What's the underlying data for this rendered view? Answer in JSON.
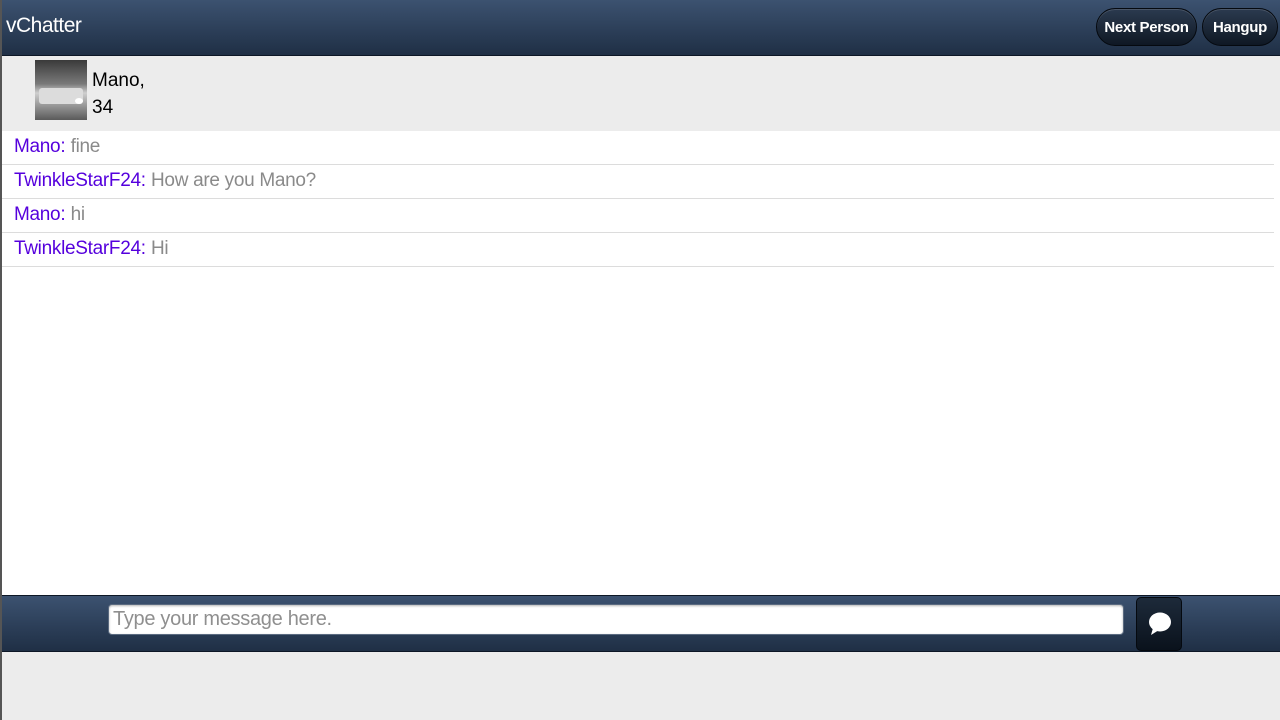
{
  "header": {
    "title": "vChatter",
    "next_label": "Next Person",
    "hangup_label": "Hangup"
  },
  "profile": {
    "name": "Mano,",
    "age": "34"
  },
  "messages": [
    {
      "sender": "Mano:",
      "text": "fine"
    },
    {
      "sender": "TwinkleStarF24:",
      "text": "How are you Mano?"
    },
    {
      "sender": "Mano:",
      "text": "hi"
    },
    {
      "sender": "TwinkleStarF24:",
      "text": "Hi"
    }
  ],
  "composer": {
    "placeholder": "Type your message here.",
    "send_icon": "chat-bubble-icon"
  },
  "colors": {
    "header_top": "#3c5270",
    "header_bottom": "#1f2f45",
    "sender": "#5500dd",
    "message_text": "#8a8a8a"
  }
}
